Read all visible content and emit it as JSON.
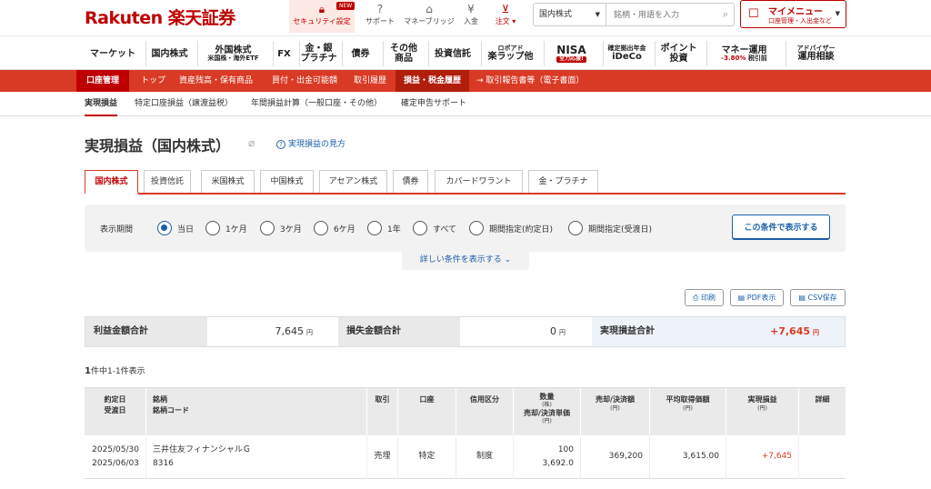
{
  "header": {
    "logo": "Rakuten 楽天証券",
    "utils": [
      {
        "label": "セキュリティ設定",
        "icon": "lock-icon",
        "badge": "NEW"
      },
      {
        "label": "サポート",
        "icon": "support-icon"
      },
      {
        "label": "マネーブリッジ",
        "icon": "bank-icon"
      },
      {
        "label": "入金",
        "icon": "deposit-icon"
      },
      {
        "label": "注文 ▾",
        "icon": "cart-icon"
      }
    ],
    "search": {
      "category": "国内株式",
      "placeholder": "銘柄・用語を入力"
    },
    "mymenu": {
      "title": "マイメニュー",
      "sub": "口座管理・入出金など"
    }
  },
  "mainnav": [
    {
      "line1": "マーケット",
      "line2": ""
    },
    {
      "line1": "国内株式",
      "line2": ""
    },
    {
      "line1": "外国株式",
      "line2": "米国株・海外ETF"
    },
    {
      "line1": "FX",
      "line2": ""
    },
    {
      "line1": "金・銀",
      "line2": "プラチナ"
    },
    {
      "line1": "債券",
      "line2": ""
    },
    {
      "line1": "その他",
      "line2": "商品"
    },
    {
      "line1": "投資信託",
      "line2": ""
    },
    {
      "line1": "ロボアド",
      "line2": "楽ラップ他"
    },
    {
      "line1": "NISA",
      "line2": "全力応援!"
    },
    {
      "line1": "確定拠出年金",
      "line2": "iDeCo"
    },
    {
      "line1": "ポイント",
      "line2": "投資"
    },
    {
      "line1": "マネー運用",
      "line2": "-3.80%",
      "line3": "税引前"
    },
    {
      "line1": "アドバイザー",
      "line2": "運用相談"
    }
  ],
  "acctbar": [
    "口座管理",
    "トップ",
    "資産残高・保有商品",
    "買付・出金可能額",
    "取引履歴",
    "損益・税金履歴",
    "→ 取引報告書等（電子書面）"
  ],
  "subnav": [
    "実現損益",
    "特定口座損益（譲渡益税）",
    "年間損益計算（一般口座・その他）",
    "確定申告サポート"
  ],
  "page": {
    "title": "実現損益（国内株式）",
    "help": "実現損益の見方"
  },
  "tabs": [
    "国内株式",
    "投資信託",
    "米国株式",
    "中国株式",
    "アセアン株式",
    "債券",
    "カバードワラント",
    "金・プラチナ"
  ],
  "filter": {
    "label": "表示期間",
    "options": [
      "当日",
      "1ケ月",
      "3ケ月",
      "6ケ月",
      "1年",
      "すべて",
      "期間指定(約定日)",
      "期間指定(受渡日)"
    ],
    "selected": "当日",
    "button": "この条件で表示する",
    "detail": "詳しい条件を表示する"
  },
  "export": {
    "print": "印刷",
    "pdf": "PDF表示",
    "csv": "CSV保存"
  },
  "summary": {
    "profit_label": "利益金額合計",
    "profit_value": "7,645",
    "loss_label": "損失金額合計",
    "loss_value": "0",
    "total_label": "実現損益合計",
    "total_value": "+7,645",
    "unit": "円"
  },
  "count": {
    "num": "1",
    "text": "件中1-1件表示"
  },
  "table": {
    "headers": {
      "date": [
        "約定日",
        "受渡日"
      ],
      "stock": [
        "銘柄",
        "銘柄コード"
      ],
      "trade": "取引",
      "account": "口座",
      "credit": "信用区分",
      "qty": [
        "数量",
        "(株)",
        "売却/決済単価",
        "(円)"
      ],
      "amount": [
        "売却/決済額",
        "(円)"
      ],
      "avg": [
        "平均取得価額",
        "(円)"
      ],
      "pl": [
        "実現損益",
        "(円)"
      ],
      "detail": "詳細"
    },
    "rows": [
      {
        "trade_date": "2025/05/30",
        "settle_date": "2025/06/03",
        "name": "三井住友フィナンシャルＧ",
        "code": "8316",
        "trade": "売埋",
        "account": "特定",
        "credit": "制度",
        "qty": "100",
        "price": "3,692.0",
        "amount": "369,200",
        "avg": "3,615.00",
        "pl": "+7,645"
      }
    ]
  }
}
